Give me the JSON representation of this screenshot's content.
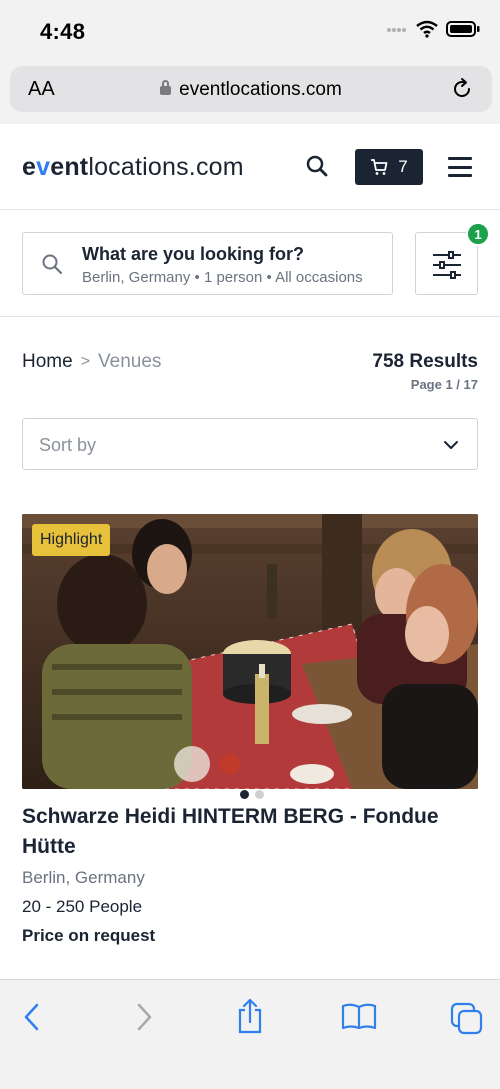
{
  "status_bar": {
    "time": "4:48"
  },
  "browser": {
    "text_size_label": "AA",
    "host": "eventlocations.com"
  },
  "header": {
    "logo": "eventlocations.com",
    "logo_parts": {
      "e": "e",
      "v": "v",
      "ent": "ent",
      "rest": "locations.com"
    },
    "cart_count": "7"
  },
  "search": {
    "title": "What are you looking for?",
    "summary": "Berlin, Germany • 1 person • All occasions",
    "filter_badge": "1"
  },
  "breadcrumb": {
    "home": "Home",
    "separator": ">",
    "current": "Venues"
  },
  "results": {
    "count": "758 Results",
    "page": "Page 1 / 17"
  },
  "sort": {
    "placeholder": "Sort by"
  },
  "listing": {
    "badge": "Highlight",
    "title": "Schwarze Heidi HINTERM BERG - Fondue Hütte",
    "location": "Berlin, Germany",
    "capacity": "20 - 250 People",
    "price": "Price on request",
    "image_count": 2,
    "active_image": 1
  },
  "colors": {
    "brand_dark": "#1b2433",
    "accent_blue": "#2f80ed",
    "badge_green": "#1aa14a",
    "highlight_yellow": "#e8c13a"
  },
  "toolbar_icons": [
    "back-icon",
    "forward-icon",
    "share-icon",
    "bookmarks-icon",
    "tabs-icon"
  ]
}
